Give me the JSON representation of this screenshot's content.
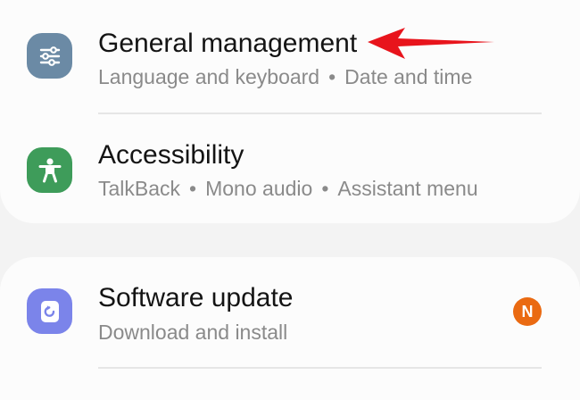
{
  "sections": [
    {
      "items": [
        {
          "title": "General management",
          "subtitle_parts": [
            "Language and keyboard",
            "Date and time"
          ],
          "icon": "sliders-icon",
          "icon_color": "#6b8aa5"
        },
        {
          "title": "Accessibility",
          "subtitle_parts": [
            "TalkBack",
            "Mono audio",
            "Assistant menu"
          ],
          "icon": "accessibility-person-icon",
          "icon_color": "#3e9c5a"
        }
      ]
    },
    {
      "items": [
        {
          "title": "Software update",
          "subtitle_parts": [
            "Download and install"
          ],
          "icon": "software-update-icon",
          "icon_color": "#7b84ea",
          "badge": "N",
          "badge_color": "#ea6a12"
        }
      ]
    }
  ],
  "separator": "•",
  "annotation": {
    "icon": "red-arrow-icon",
    "color": "#e8141c"
  }
}
